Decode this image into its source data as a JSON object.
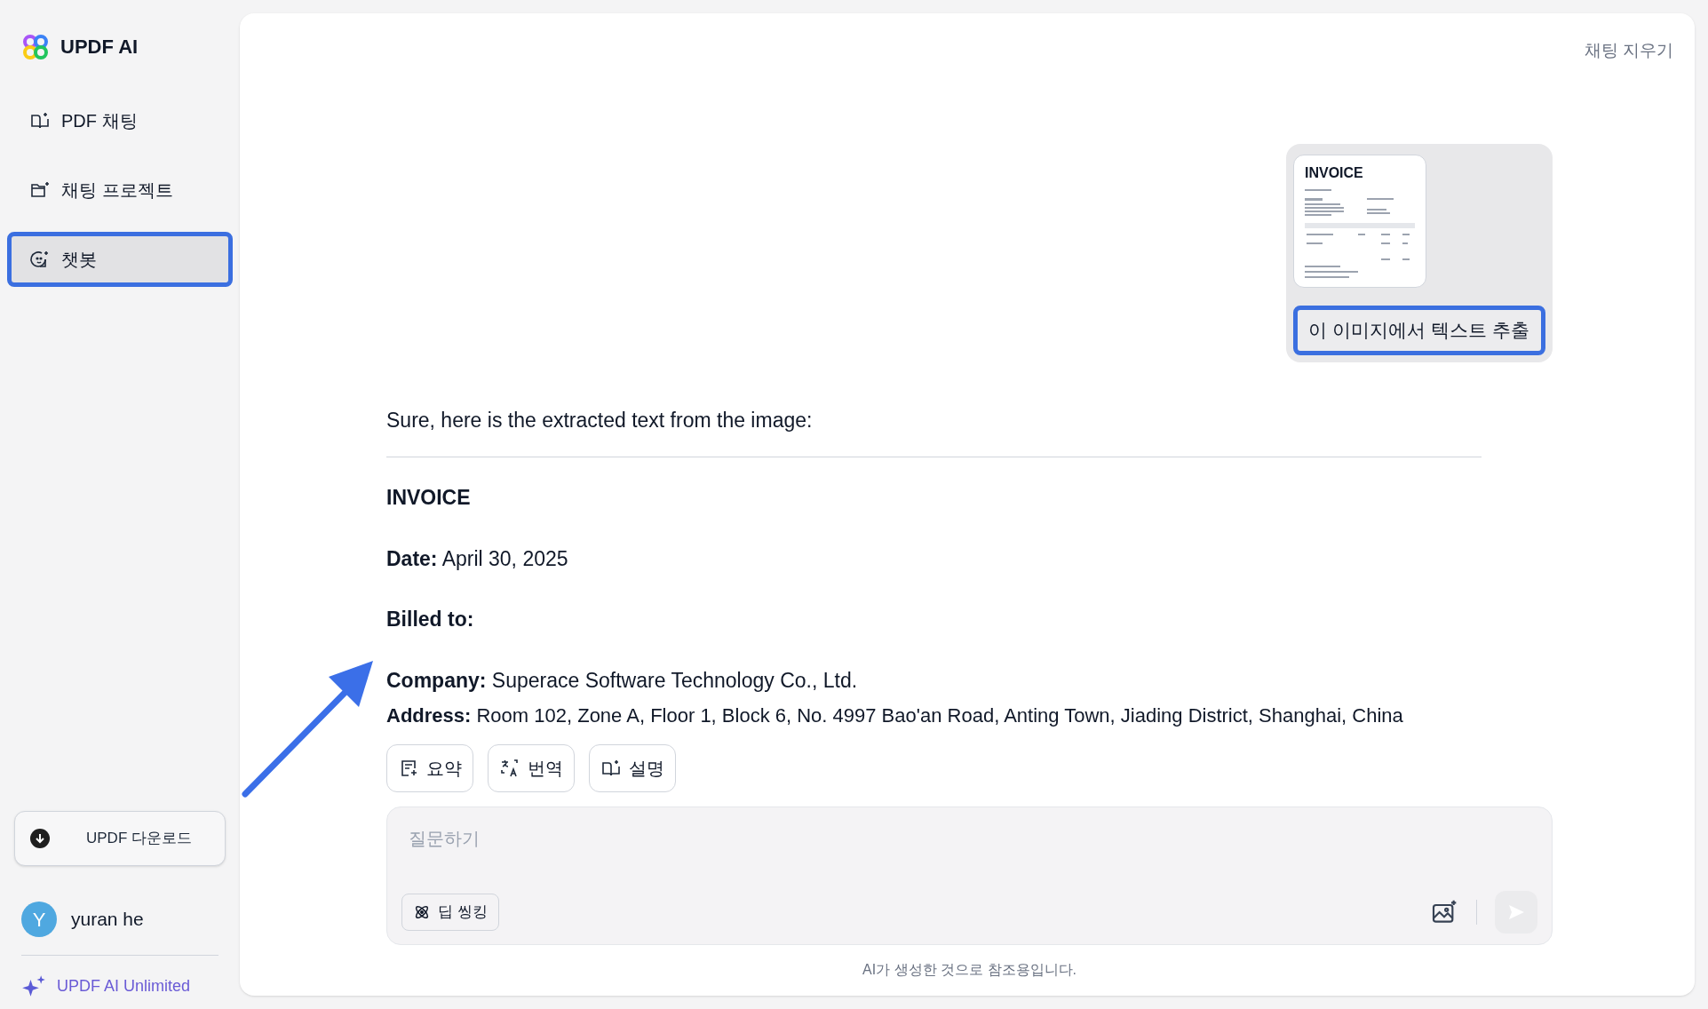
{
  "sidebar": {
    "logo": "UPDF AI",
    "items": [
      {
        "label": "PDF 채팅",
        "selected": false
      },
      {
        "label": "채팅 프로젝트",
        "selected": false
      },
      {
        "label": "챗봇",
        "selected": true
      }
    ],
    "download_button": "UPDF 다운로드",
    "user": {
      "initial": "Y",
      "name": "yuran he"
    },
    "plan": "UPDF AI Unlimited"
  },
  "header": {
    "clear_button": "채팅 지우기"
  },
  "user_message": {
    "attachment": {
      "title": "INVOICE"
    },
    "text": "이 이미지에서 텍스트 추출"
  },
  "response": {
    "intro": "Sure, here is the extracted text from the image:",
    "lines": [
      "**INVOICE**",
      "**Date:** April 30, 2025",
      "**Billed to:**",
      "**Company:** Superace Software Technology Co., Ltd.",
      "**Address:** Room 102, Zone A, Floor 1, Block 6, No. 4997 Bao'an Road, Anting Town, Jiading District, Shanghai, China"
    ]
  },
  "actions": [
    {
      "label": "요약"
    },
    {
      "label": "번역"
    },
    {
      "label": "설명"
    }
  ],
  "composer": {
    "placeholder": "질문하기",
    "deep_thinking": "딥 씽킹"
  },
  "footer": "AI가 생성한 것으로 참조용입니다."
}
